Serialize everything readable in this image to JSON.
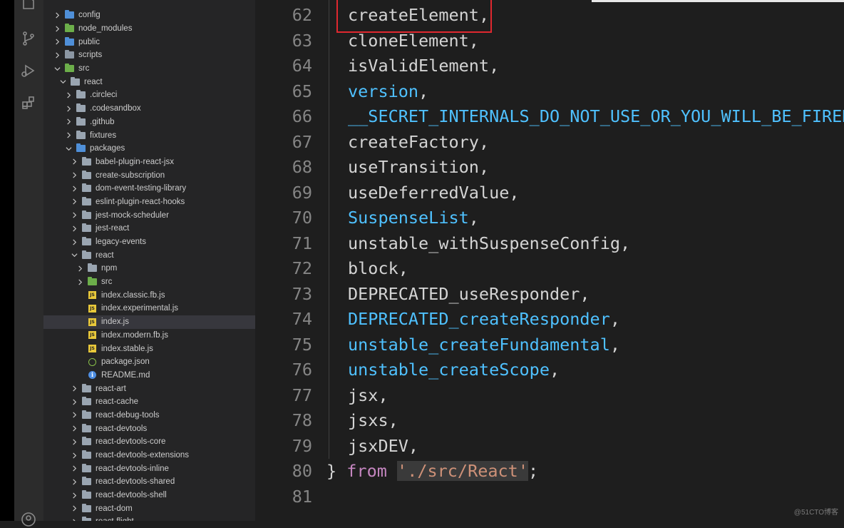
{
  "activity_bar": {
    "icons": [
      "explorer-icon",
      "source-control-icon",
      "run-debug-icon",
      "extensions-icon",
      "account-icon"
    ]
  },
  "explorer": {
    "rows": [
      {
        "label": "config",
        "depth": 0,
        "chevron": "right",
        "icon": "folder-blue"
      },
      {
        "label": "node_modules",
        "depth": 0,
        "chevron": "right",
        "icon": "folder-green"
      },
      {
        "label": "public",
        "depth": 0,
        "chevron": "right",
        "icon": "folder-blue"
      },
      {
        "label": "scripts",
        "depth": 0,
        "chevron": "right",
        "icon": "folder-gray"
      },
      {
        "label": "src",
        "depth": 0,
        "chevron": "down",
        "icon": "folder-green"
      },
      {
        "label": "react",
        "depth": 1,
        "chevron": "down",
        "icon": "folder"
      },
      {
        "label": ".circleci",
        "depth": 2,
        "chevron": "right",
        "icon": "folder"
      },
      {
        "label": ".codesandbox",
        "depth": 2,
        "chevron": "right",
        "icon": "folder"
      },
      {
        "label": ".github",
        "depth": 2,
        "chevron": "right",
        "icon": "folder"
      },
      {
        "label": "fixtures",
        "depth": 2,
        "chevron": "right",
        "icon": "folder"
      },
      {
        "label": "packages",
        "depth": 2,
        "chevron": "down",
        "icon": "folder-blue"
      },
      {
        "label": "babel-plugin-react-jsx",
        "depth": 3,
        "chevron": "right",
        "icon": "folder"
      },
      {
        "label": "create-subscription",
        "depth": 3,
        "chevron": "right",
        "icon": "folder"
      },
      {
        "label": "dom-event-testing-library",
        "depth": 3,
        "chevron": "right",
        "icon": "folder"
      },
      {
        "label": "eslint-plugin-react-hooks",
        "depth": 3,
        "chevron": "right",
        "icon": "folder"
      },
      {
        "label": "jest-mock-scheduler",
        "depth": 3,
        "chevron": "right",
        "icon": "folder"
      },
      {
        "label": "jest-react",
        "depth": 3,
        "chevron": "right",
        "icon": "folder"
      },
      {
        "label": "legacy-events",
        "depth": 3,
        "chevron": "right",
        "icon": "folder"
      },
      {
        "label": "react",
        "depth": 3,
        "chevron": "down",
        "icon": "folder"
      },
      {
        "label": "npm",
        "depth": 4,
        "chevron": "right",
        "icon": "folder"
      },
      {
        "label": "src",
        "depth": 4,
        "chevron": "right",
        "icon": "folder-green"
      },
      {
        "label": "index.classic.fb.js",
        "depth": 4,
        "chevron": "none",
        "icon": "js"
      },
      {
        "label": "index.experimental.js",
        "depth": 4,
        "chevron": "none",
        "icon": "js"
      },
      {
        "label": "index.js",
        "depth": 4,
        "chevron": "none",
        "icon": "js",
        "selected": true
      },
      {
        "label": "index.modern.fb.js",
        "depth": 4,
        "chevron": "none",
        "icon": "js"
      },
      {
        "label": "index.stable.js",
        "depth": 4,
        "chevron": "none",
        "icon": "js"
      },
      {
        "label": "package.json",
        "depth": 4,
        "chevron": "none",
        "icon": "json"
      },
      {
        "label": "README.md",
        "depth": 4,
        "chevron": "none",
        "icon": "md"
      },
      {
        "label": "react-art",
        "depth": 3,
        "chevron": "right",
        "icon": "folder"
      },
      {
        "label": "react-cache",
        "depth": 3,
        "chevron": "right",
        "icon": "folder"
      },
      {
        "label": "react-debug-tools",
        "depth": 3,
        "chevron": "right",
        "icon": "folder"
      },
      {
        "label": "react-devtools",
        "depth": 3,
        "chevron": "right",
        "icon": "folder"
      },
      {
        "label": "react-devtools-core",
        "depth": 3,
        "chevron": "right",
        "icon": "folder"
      },
      {
        "label": "react-devtools-extensions",
        "depth": 3,
        "chevron": "right",
        "icon": "folder"
      },
      {
        "label": "react-devtools-inline",
        "depth": 3,
        "chevron": "right",
        "icon": "folder"
      },
      {
        "label": "react-devtools-shared",
        "depth": 3,
        "chevron": "right",
        "icon": "folder"
      },
      {
        "label": "react-devtools-shell",
        "depth": 3,
        "chevron": "right",
        "icon": "folder"
      },
      {
        "label": "react-dom",
        "depth": 3,
        "chevron": "right",
        "icon": "folder"
      },
      {
        "label": "react-flight",
        "depth": 3,
        "chevron": "right",
        "icon": "folder"
      }
    ]
  },
  "editor": {
    "lines": [
      {
        "num": "62",
        "tokens": [
          {
            "t": "createElement",
            "c": "var"
          },
          {
            "t": ",",
            "c": "pun"
          }
        ]
      },
      {
        "num": "63",
        "tokens": [
          {
            "t": "cloneElement",
            "c": "var"
          },
          {
            "t": ",",
            "c": "pun"
          }
        ]
      },
      {
        "num": "64",
        "tokens": [
          {
            "t": "isValidElement",
            "c": "var"
          },
          {
            "t": ",",
            "c": "pun"
          }
        ]
      },
      {
        "num": "65",
        "tokens": [
          {
            "t": "version",
            "c": "cls"
          },
          {
            "t": ",",
            "c": "pun"
          }
        ]
      },
      {
        "num": "66",
        "tokens": [
          {
            "t": "__SECRET_INTERNALS_DO_NOT_USE_OR_YOU_WILL_BE_FIRED",
            "c": "cls"
          }
        ]
      },
      {
        "num": "67",
        "tokens": [
          {
            "t": "createFactory",
            "c": "var"
          },
          {
            "t": ",",
            "c": "pun"
          }
        ]
      },
      {
        "num": "68",
        "tokens": [
          {
            "t": "useTransition",
            "c": "var"
          },
          {
            "t": ",",
            "c": "pun"
          }
        ]
      },
      {
        "num": "69",
        "tokens": [
          {
            "t": "useDeferredValue",
            "c": "var"
          },
          {
            "t": ",",
            "c": "pun"
          }
        ]
      },
      {
        "num": "70",
        "tokens": [
          {
            "t": "SuspenseList",
            "c": "cls"
          },
          {
            "t": ",",
            "c": "pun"
          }
        ]
      },
      {
        "num": "71",
        "tokens": [
          {
            "t": "unstable_withSuspenseConfig",
            "c": "var"
          },
          {
            "t": ",",
            "c": "pun"
          }
        ]
      },
      {
        "num": "72",
        "tokens": [
          {
            "t": "block",
            "c": "var"
          },
          {
            "t": ",",
            "c": "pun"
          }
        ]
      },
      {
        "num": "73",
        "tokens": [
          {
            "t": "DEPRECATED_useResponder",
            "c": "var"
          },
          {
            "t": ",",
            "c": "pun"
          }
        ]
      },
      {
        "num": "74",
        "tokens": [
          {
            "t": "DEPRECATED_createResponder",
            "c": "cls"
          },
          {
            "t": ",",
            "c": "pun"
          }
        ]
      },
      {
        "num": "75",
        "tokens": [
          {
            "t": "unstable_createFundamental",
            "c": "cls"
          },
          {
            "t": ",",
            "c": "pun"
          }
        ]
      },
      {
        "num": "76",
        "tokens": [
          {
            "t": "unstable_createScope",
            "c": "cls"
          },
          {
            "t": ",",
            "c": "pun"
          }
        ]
      },
      {
        "num": "77",
        "tokens": [
          {
            "t": "jsx",
            "c": "var"
          },
          {
            "t": ",",
            "c": "pun"
          }
        ]
      },
      {
        "num": "78",
        "tokens": [
          {
            "t": "jsxs",
            "c": "var"
          },
          {
            "t": ",",
            "c": "pun"
          }
        ]
      },
      {
        "num": "79",
        "tokens": [
          {
            "t": "jsxDEV",
            "c": "var"
          },
          {
            "t": ",",
            "c": "pun"
          }
        ]
      },
      {
        "num": "80",
        "tokens": [
          {
            "t": "} ",
            "c": "pun"
          },
          {
            "t": "from",
            "c": "kw"
          },
          {
            "t": " ",
            "c": "pun"
          },
          {
            "t": "'./src/React'",
            "c": "str"
          },
          {
            "t": ";",
            "c": "pun"
          }
        ]
      },
      {
        "num": "81",
        "tokens": []
      }
    ]
  },
  "watermark": "@51CTO博客"
}
